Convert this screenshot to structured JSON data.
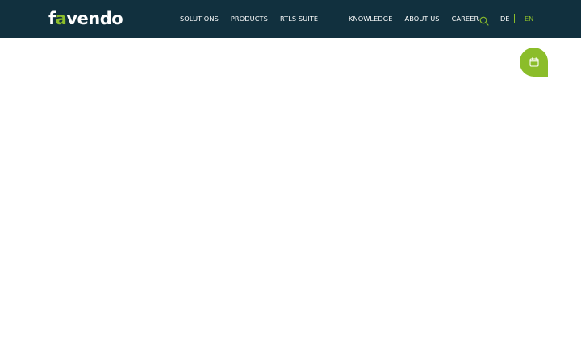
{
  "brand": {
    "logo_prefix": "f",
    "logo_o": "a",
    "logo_suffix": "vendo",
    "header_color": "#11303e",
    "accent_color": "#8bbd2a"
  },
  "nav": {
    "left": [
      {
        "label": "SOLUTIONS"
      },
      {
        "label": "PRODUCTS"
      },
      {
        "label": "RTLS SUITE"
      }
    ],
    "right": [
      {
        "label": "KNOWLEDGE"
      },
      {
        "label": "ABOUT US"
      },
      {
        "label": "CAREER"
      }
    ]
  },
  "search": {
    "icon": "search-icon"
  },
  "language": {
    "options": [
      "DE",
      "EN"
    ],
    "selected": "EN"
  },
  "floating_action": {
    "icon": "calendar-icon"
  }
}
